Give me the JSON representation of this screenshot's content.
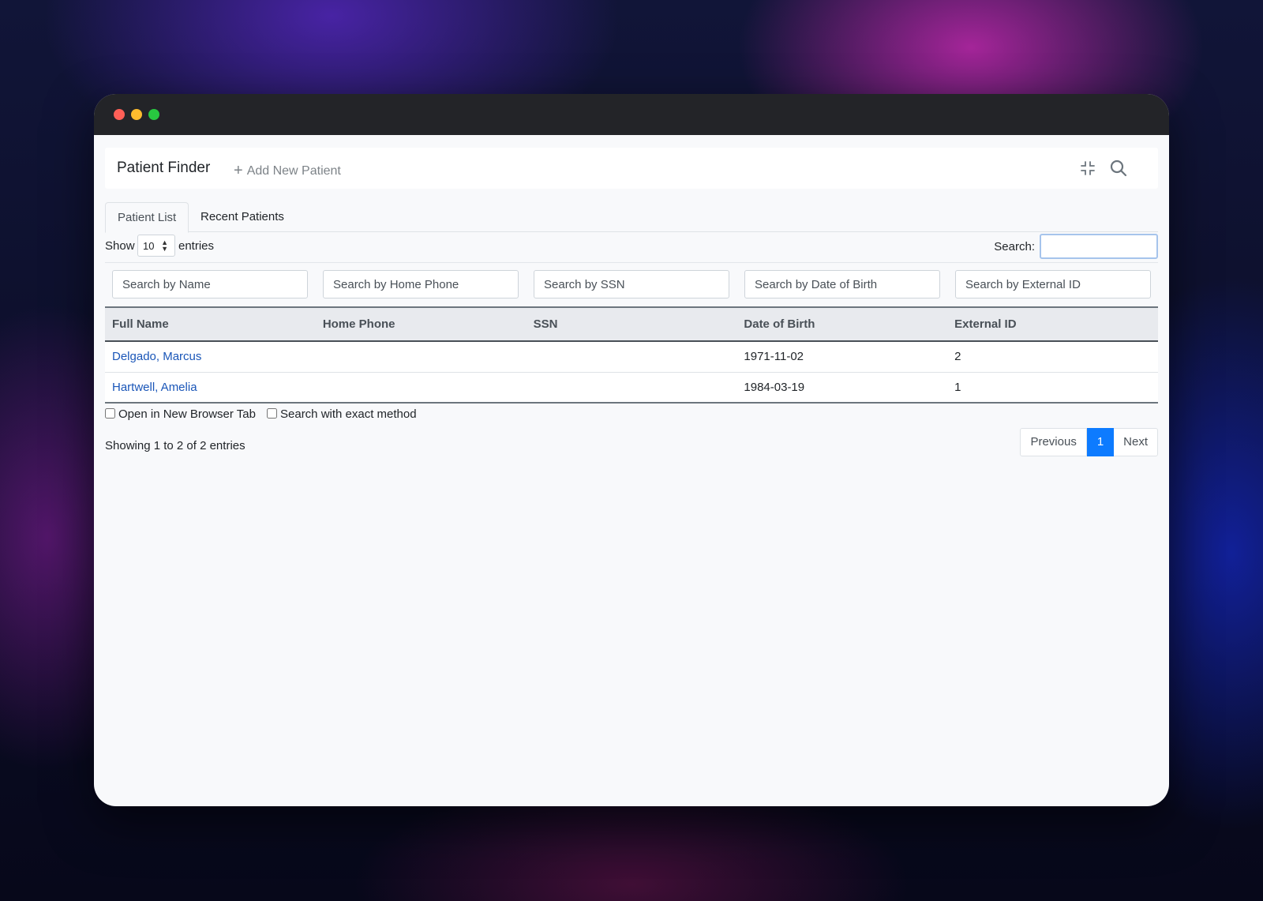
{
  "navbar": {
    "brand": "Patient Finder",
    "add_label": "Add New Patient"
  },
  "tabs": [
    {
      "label": "Patient List",
      "active": true
    },
    {
      "label": "Recent Patients",
      "active": false
    }
  ],
  "controls": {
    "show_label": "Show",
    "page_size": "10",
    "entries_label": "entries",
    "search_label": "Search:",
    "search_value": ""
  },
  "filters": [
    {
      "placeholder": "Search by Name"
    },
    {
      "placeholder": "Search by Home Phone"
    },
    {
      "placeholder": "Search by SSN"
    },
    {
      "placeholder": "Search by Date of Birth"
    },
    {
      "placeholder": "Search by External ID"
    }
  ],
  "table": {
    "columns": [
      "Full Name",
      "Home Phone",
      "SSN",
      "Date of Birth",
      "External ID"
    ],
    "rows": [
      {
        "name": "Delgado, Marcus",
        "home_phone": "",
        "ssn": "",
        "dob": "1971-11-02",
        "external_id": "2"
      },
      {
        "name": "Hartwell, Amelia",
        "home_phone": "",
        "ssn": "",
        "dob": "1984-03-19",
        "external_id": "1"
      }
    ]
  },
  "options": {
    "open_new_tab": "Open in New Browser Tab",
    "exact_method": "Search with exact method"
  },
  "footer": {
    "info": "Showing 1 to 2 of 2 entries",
    "previous": "Previous",
    "current_page": "1",
    "next": "Next"
  },
  "colors": {
    "accent": "#0d7bff",
    "link": "#1a56b8",
    "titlebar": "#232428"
  },
  "icons": [
    "compress-icon",
    "search-icon",
    "plus-icon",
    "sort-arrows-icon"
  ]
}
